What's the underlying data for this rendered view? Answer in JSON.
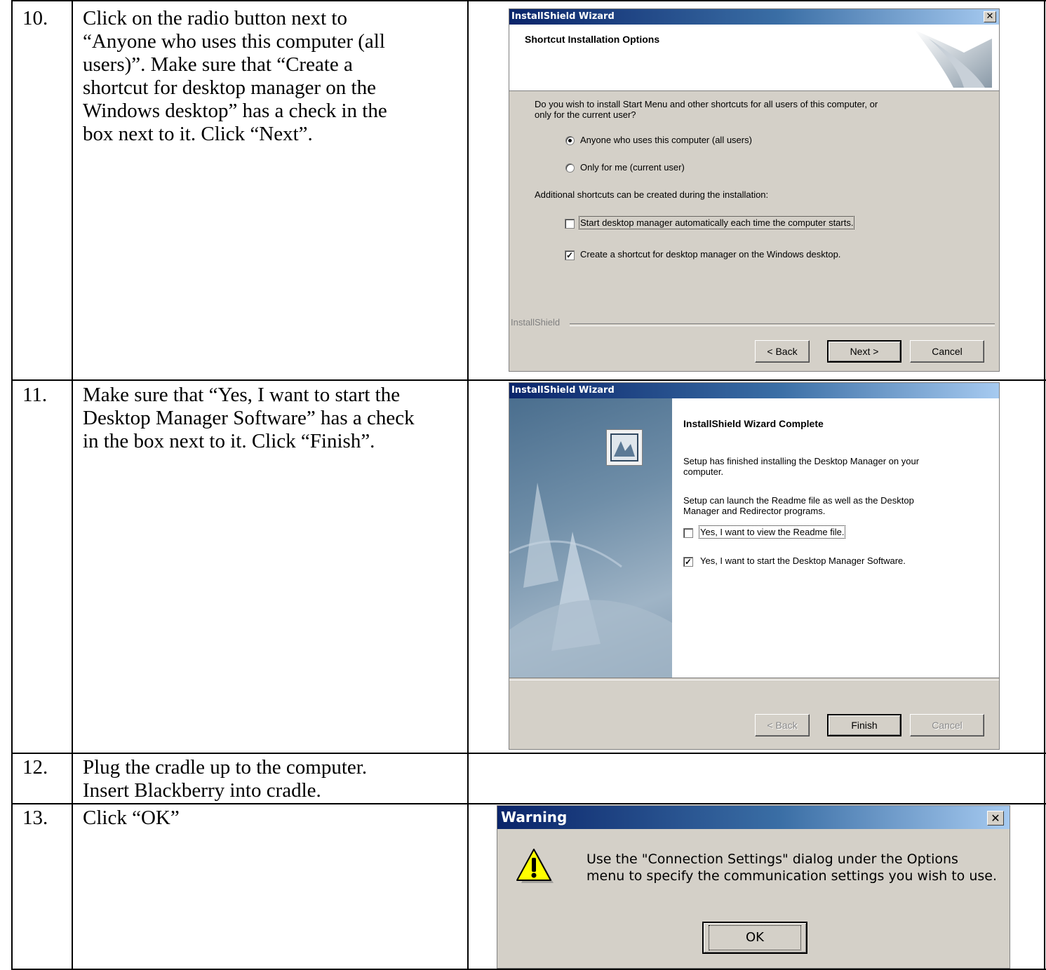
{
  "rows": [
    {
      "number": "10.",
      "instruction_lines": [
        "Click on the radio button next to",
        "“Anyone who uses this computer (all",
        "users)”.  Make sure that “Create a",
        "shortcut for desktop manager on the",
        "Windows desktop” has a check in the",
        "box next to it.  Click “Next”."
      ]
    },
    {
      "number": "11.",
      "instruction_lines": [
        "Make sure that “Yes, I want to start the",
        "Desktop Manager Software” has a check",
        "in the box next to it.  Click “Finish”."
      ]
    },
    {
      "number": "12.",
      "instruction_lines": [
        "Plug the cradle up to the computer.",
        "Insert Blackberry into cradle."
      ]
    },
    {
      "number": "13.",
      "instruction_lines": [
        "Click “OK”"
      ]
    }
  ],
  "dialog_shortcuts": {
    "title": "InstallShield Wizard",
    "header": "Shortcut Installation Options",
    "question_line1": "Do you wish to install Start Menu and other shortcuts for all users of this computer, or",
    "question_line2": "only for the current user?",
    "radio_all_users": "Anyone who uses this computer (all users)",
    "radio_all_users_selected": true,
    "radio_current_user": "Only for me (current user)",
    "additional": "Additional shortcuts can be created during the installation:",
    "check_start_auto": "Start desktop manager automatically each time the computer starts.",
    "check_start_auto_checked": false,
    "check_desktop_shortcut": "Create a shortcut for desktop manager on the Windows desktop.",
    "check_desktop_shortcut_checked": true,
    "brand": "InstallShield",
    "back": "< Back",
    "next": "Next >",
    "cancel": "Cancel"
  },
  "dialog_complete": {
    "title": "InstallShield Wizard",
    "heading": "InstallShield Wizard Complete",
    "para1_line1": "Setup has finished installing the Desktop Manager on your",
    "para1_line2": "computer.",
    "para2_line1": "Setup can launch the Readme file as well as the Desktop",
    "para2_line2": "Manager and Redirector programs.",
    "check_readme": "Yes, I want to view the Readme file.",
    "check_readme_checked": false,
    "check_start": "Yes, I want to start the Desktop Manager Software.",
    "check_start_checked": true,
    "back": "< Back",
    "finish": "Finish",
    "cancel": "Cancel"
  },
  "dialog_warning": {
    "title": "Warning",
    "message_line1": "Use the \"Connection Settings\" dialog under the Options",
    "message_line2": "menu to specify the communication settings you wish to use.",
    "ok": "OK"
  },
  "colors": {
    "dialog_face": "#d4d0c8",
    "titlebar_start": "#0a246a",
    "titlebar_end": "#a6caf0",
    "warning_yellow": "#ffff00"
  }
}
